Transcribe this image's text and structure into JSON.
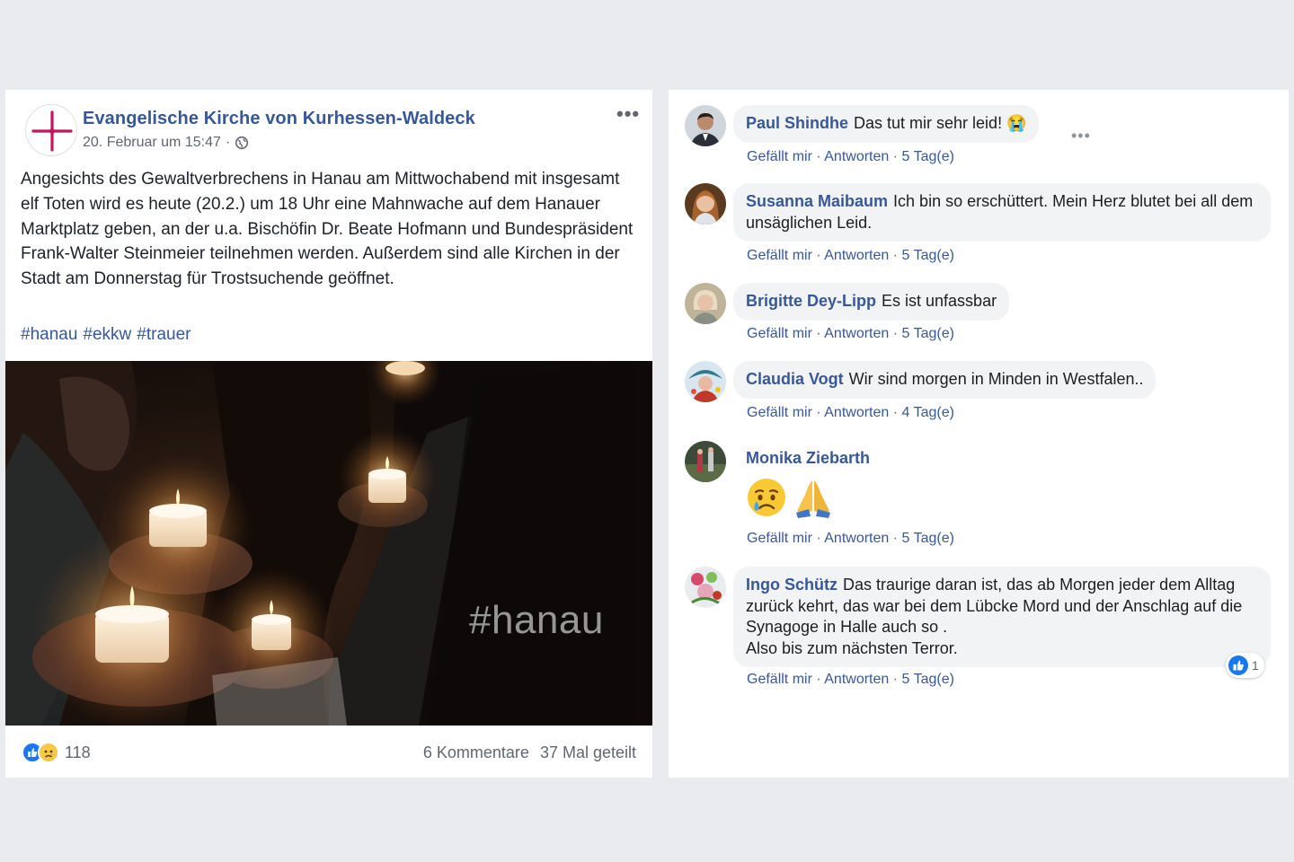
{
  "post": {
    "page_name": "Evangelische Kirche von Kurhessen-Waldeck",
    "date": "20. Februar um 15:47",
    "separator": "·",
    "more_label": "•••",
    "body": "Angesichts des Gewaltverbrechens in Hanau am Mittwochabend mit insgesamt elf Toten wird es heute (20.2.) um 18 Uhr eine Mahnwache auf dem Hanauer Marktplatz geben, an der u.a. Bischöfin Dr. Beate Hofmann und Bundespräsident Frank-Walter Steinmeier teilnehmen werden. Außerdem sind alle Kirchen in der Stadt am Donnerstag für Trostsuchende geöffnet.",
    "hashtags": [
      "#hanau",
      "#ekkw",
      "#trauer"
    ],
    "photo_caption": "#hanau",
    "reaction_count": "118",
    "comments_count": "6 Kommentare",
    "shares_count": "37 Mal geteilt"
  },
  "comments": [
    {
      "name": "Paul Shindhe",
      "text": "Das tut mir sehr leid! 😭",
      "like": "Gefällt mir",
      "reply": "Antworten",
      "time": "5 Tag(e)"
    },
    {
      "name": "Susanna Maibaum",
      "text": "Ich bin so erschüttert. Mein Herz blutet bei all dem unsäglichen Leid.",
      "like": "Gefällt mir",
      "reply": "Antworten",
      "time": "5 Tag(e)"
    },
    {
      "name": "Brigitte Dey-Lipp",
      "text": "Es ist unfassbar",
      "like": "Gefällt mir",
      "reply": "Antworten",
      "time": "5 Tag(e)"
    },
    {
      "name": "Claudia Vogt",
      "text": "Wir sind morgen in Minden in Westfalen..",
      "like": "Gefällt mir",
      "reply": "Antworten",
      "time": "4 Tag(e)"
    },
    {
      "name": "Monika Ziebarth",
      "text": "",
      "like": "Gefällt mir",
      "reply": "Antworten",
      "time": "5 Tag(e)"
    },
    {
      "name": "Ingo Schütz",
      "text": "Das traurige daran ist, das ab Morgen jeder dem Alltag zurück kehrt, das war bei dem Lübcke Mord und der Anschlag auf die Synagoge in Halle auch so .",
      "text2": "Also bis zum nächsten Terror.",
      "like": "Gefällt mir",
      "reply": "Antworten",
      "time": "5 Tag(e)",
      "likes": "1"
    }
  ],
  "ui": {
    "dot": "·",
    "comment_more": "•••"
  },
  "colors": {
    "link": "#365899",
    "meta": "#616770",
    "bubble": "#f2f3f5",
    "like_blue": "#1877f2"
  }
}
